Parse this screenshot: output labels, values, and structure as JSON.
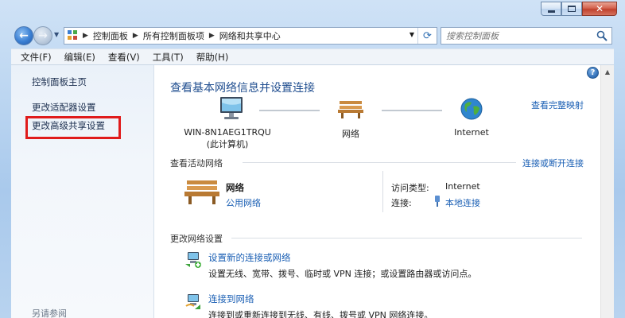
{
  "window": {
    "minimize": "",
    "maximize": "",
    "close": "✕"
  },
  "address": {
    "crumbs": [
      "控制面板",
      "所有控制面板项",
      "网络和共享中心"
    ],
    "search_placeholder": "搜索控制面板"
  },
  "menu": [
    "文件(F)",
    "编辑(E)",
    "查看(V)",
    "工具(T)",
    "帮助(H)"
  ],
  "sidebar": {
    "items": [
      "控制面板主页",
      "更改适配器设置",
      "更改高级共享设置"
    ],
    "see_also": "另请参阅"
  },
  "main": {
    "heading": "查看基本网络信息并设置连接",
    "full_map_link": "查看完整映射",
    "map": {
      "computer_name": "WIN-8N1AEG1TRQU",
      "computer_sub": "(此计算机)",
      "network": "网络",
      "internet": "Internet"
    },
    "active_section": "查看活动网络",
    "connect_disconnect": "连接或断开连接",
    "active": {
      "name": "网络",
      "type": "公用网络",
      "access_label": "访问类型:",
      "access_value": "Internet",
      "conn_label": "连接:",
      "conn_value": "本地连接"
    },
    "change_section": "更改网络设置",
    "tasks": [
      {
        "title": "设置新的连接或网络",
        "desc": "设置无线、宽带、拨号、临时或 VPN 连接；或设置路由器或访问点。"
      },
      {
        "title": "连接到网络",
        "desc": "连接到或重新连接到无线、有线、拨号或 VPN 网络连接。"
      }
    ]
  },
  "colors": {
    "link": "#1a5fb4",
    "heading": "#1f4d8f",
    "highlight_box": "#e01b1b"
  }
}
